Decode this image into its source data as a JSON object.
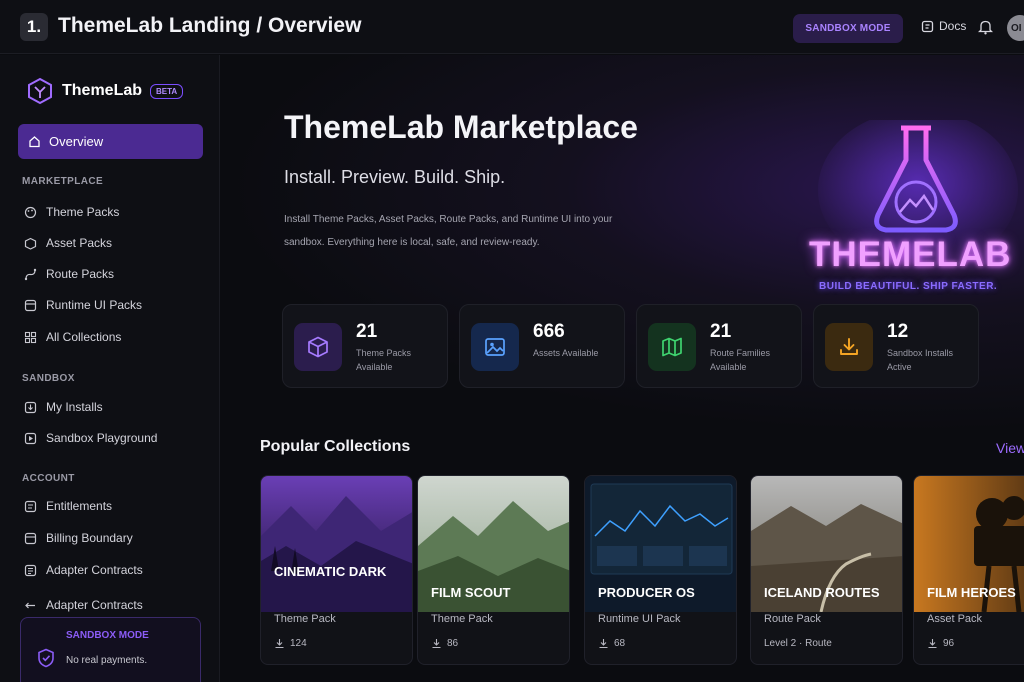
{
  "topbar": {
    "step": "1.",
    "title": "ThemeLab Landing / Overview",
    "sandbox_chip": "SANDBOX MODE",
    "docs_label": "Docs",
    "avatar_initials": "OI"
  },
  "sidebar": {
    "brand": "ThemeLab",
    "badge": "BETA",
    "active_item": "Overview",
    "sections": [
      {
        "label": "MARKETPLACE",
        "items": [
          "Theme Packs",
          "Asset Packs",
          "Route Packs",
          "Runtime UI Packs",
          "All Collections"
        ]
      },
      {
        "label": "SANDBOX",
        "items": [
          "My Installs",
          "Sandbox Playground"
        ]
      },
      {
        "label": "ACCOUNT",
        "items": [
          "Entitlements",
          "Billing Boundary",
          "Adapter Contracts",
          "Adapter Contracts"
        ]
      }
    ],
    "sandbox_card": {
      "title": "SANDBOX MODE",
      "text": "No real payments."
    }
  },
  "hero": {
    "title": "ThemeLab Marketplace",
    "tagline": "Install. Preview. Build. Ship.",
    "description": "Install Theme Packs, Asset Packs, Route Packs, and Runtime UI into your sandbox. Everything here is local, safe, and review-ready.",
    "art_name": "THEMELAB",
    "art_slogan": "BUILD BEAUTIFUL. SHIP FASTER."
  },
  "stats": [
    {
      "value": "21",
      "label": "Theme Packs Available",
      "icon": "cube-icon",
      "color": "#8b5cf6"
    },
    {
      "value": "666",
      "label": "Assets Available",
      "icon": "image-icon",
      "color": "#3b82f6"
    },
    {
      "value": "21",
      "label": "Route Families Available",
      "icon": "map-icon",
      "color": "#22c55e"
    },
    {
      "value": "12",
      "label": "Sandbox Installs Active",
      "icon": "download-icon",
      "color": "#f59e0b"
    }
  ],
  "collections": {
    "title": "Popular Collections",
    "view_all": "View all",
    "items": [
      {
        "name": "Cinematic Dark",
        "type": "Theme Pack",
        "meta": "124"
      },
      {
        "name": "Film Scout",
        "type": "Theme Pack",
        "meta": "86"
      },
      {
        "name": "Producer OS",
        "type": "Runtime UI Pack",
        "meta": "68"
      },
      {
        "name": "Iceland Routes",
        "type": "Route Pack",
        "meta": "Level 2 · Route"
      },
      {
        "name": "Film Heroes",
        "type": "Asset Pack",
        "meta": "96"
      }
    ]
  }
}
